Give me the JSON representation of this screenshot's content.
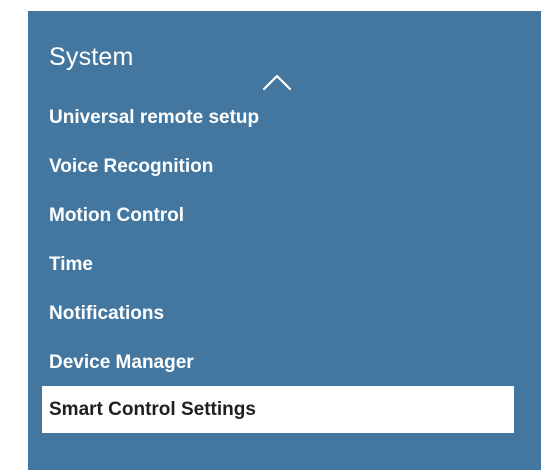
{
  "menu": {
    "title": "System",
    "items": [
      {
        "label": "Universal remote setup"
      },
      {
        "label": "Voice Recognition"
      },
      {
        "label": "Motion Control"
      },
      {
        "label": "Time"
      },
      {
        "label": "Notifications"
      },
      {
        "label": "Device Manager"
      },
      {
        "label": "Smart Control Settings",
        "selected": true
      }
    ],
    "scroll_up_icon": "chevron-up-icon"
  },
  "colors": {
    "panel_background": "#44779f",
    "text": "#ffffff",
    "selected_background": "#ffffff",
    "selected_text": "#1f1f1f"
  }
}
